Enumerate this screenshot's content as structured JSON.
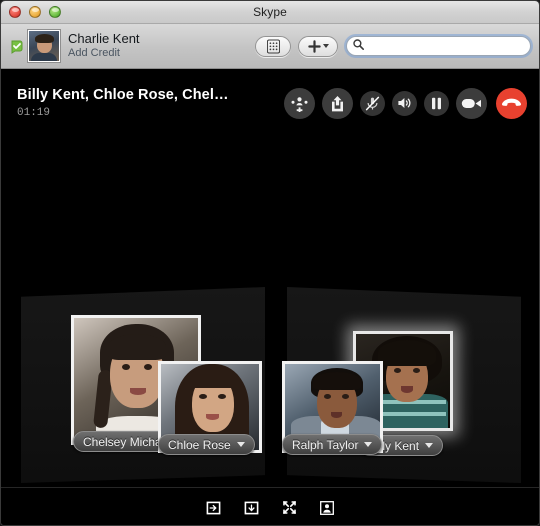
{
  "window": {
    "title": "Skype",
    "controls": [
      {
        "name": "close",
        "label": "Close"
      },
      {
        "name": "minimize",
        "label": "Minimize"
      },
      {
        "name": "zoom",
        "label": "Zoom"
      }
    ]
  },
  "toolbar": {
    "status_icon": "online-status-icon",
    "avatar_icon": "user-avatar",
    "account_name": "Charlie Kent",
    "add_credit_label": "Add Credit",
    "dialpad_icon": "dialpad-icon",
    "add_icon": "plus-icon",
    "search": {
      "icon": "search-icon",
      "value": "",
      "placeholder": ""
    }
  },
  "call": {
    "participants_title": "Billy Kent, Chloe Rose, Chel…",
    "duration": "01:19",
    "controls": [
      {
        "name": "add-people-button",
        "icon": "add-people-icon",
        "label": "Add People"
      },
      {
        "name": "share-button",
        "icon": "share-icon",
        "label": "Share"
      },
      {
        "name": "mute-button",
        "icon": "microphone-muted-icon",
        "label": "Mute"
      },
      {
        "name": "speaker-button",
        "icon": "speaker-icon",
        "label": "Speaker"
      },
      {
        "name": "hold-button",
        "icon": "pause-icon",
        "label": "Hold"
      },
      {
        "name": "video-button",
        "icon": "video-camera-icon",
        "label": "Video"
      },
      {
        "name": "end-call-button",
        "icon": "hangup-icon",
        "label": "End Call"
      }
    ]
  },
  "participants": [
    {
      "name": "Chelsey Michaels",
      "active": false,
      "caret_icon": "chevron-down-icon"
    },
    {
      "name": "Billy Kent",
      "active": true,
      "caret_icon": "chevron-down-icon"
    },
    {
      "name": "Chloe Rose",
      "active": false,
      "caret_icon": "chevron-down-icon"
    },
    {
      "name": "Ralph Taylor",
      "active": false,
      "caret_icon": "chevron-down-icon"
    }
  ],
  "bottom_bar": {
    "buttons": [
      {
        "name": "show-sidebar-button",
        "icon": "panel-right-icon",
        "label": "Show Sidebar"
      },
      {
        "name": "show-bottom-panel-button",
        "icon": "panel-bottom-icon",
        "label": "Show Bottom Panel"
      },
      {
        "name": "fullscreen-button",
        "icon": "fullscreen-icon",
        "label": "Full Screen"
      },
      {
        "name": "contact-info-button",
        "icon": "contact-card-icon",
        "label": "Contact Info"
      }
    ]
  },
  "colors": {
    "hangup_red": "#e8412f",
    "status_green": "#78c143",
    "stage_black": "#000000",
    "control_gray": "#3c3c3c"
  }
}
